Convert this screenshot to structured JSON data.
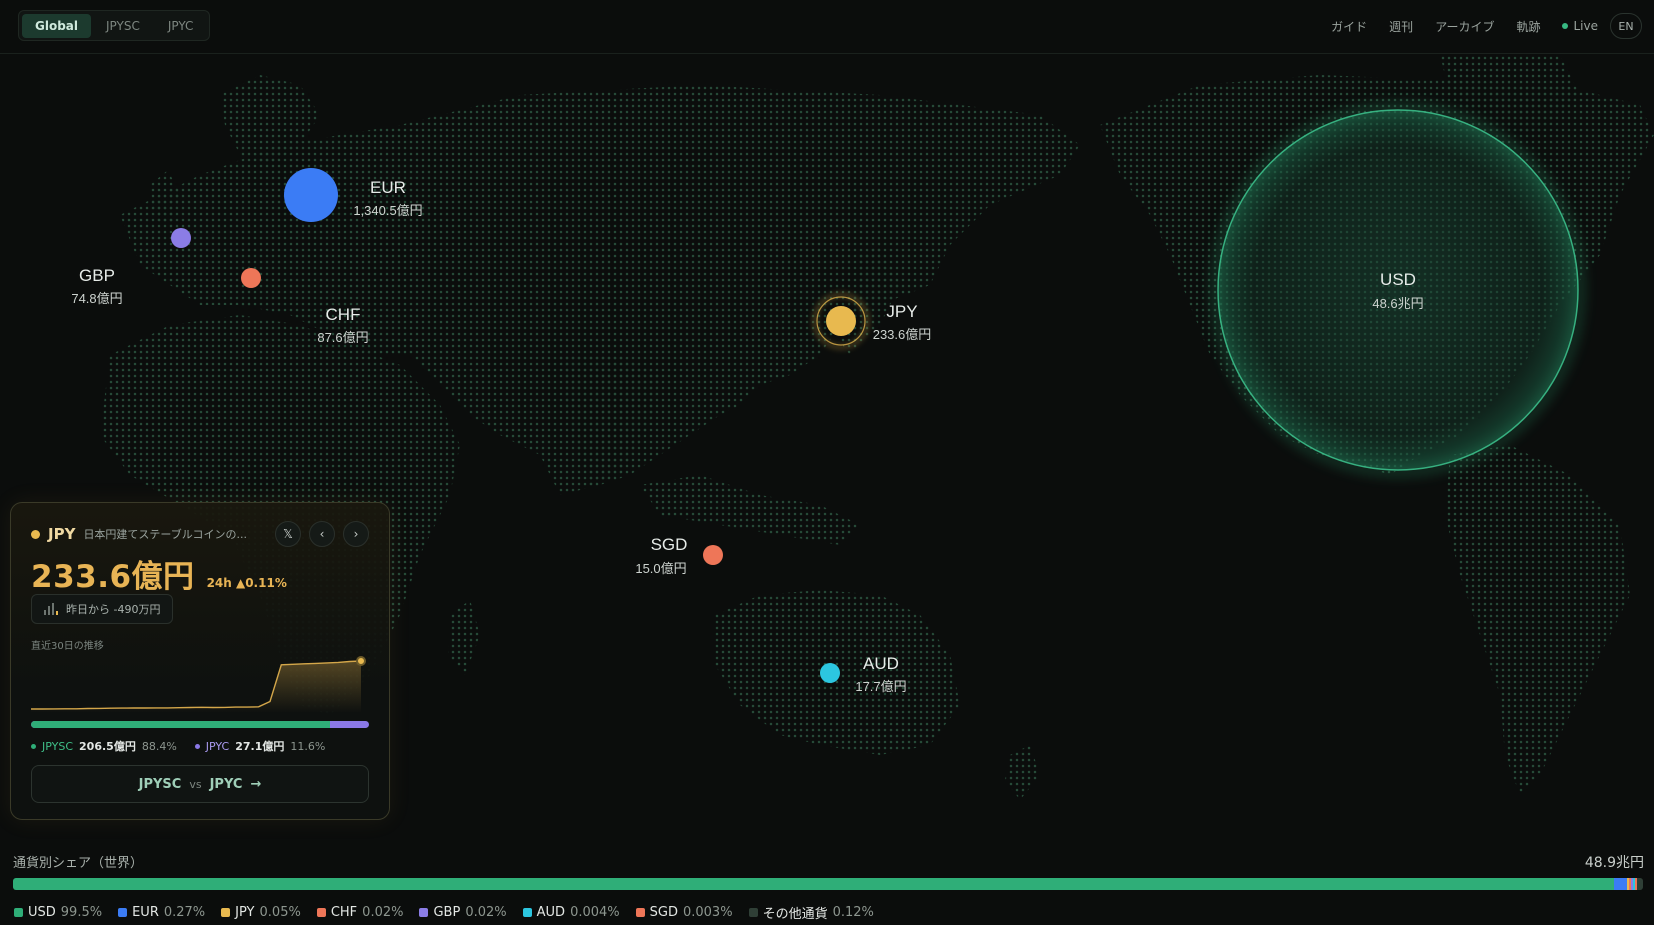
{
  "scope_tabs": [
    {
      "label": "Global",
      "active": true
    },
    {
      "label": "JPYSC",
      "active": false
    },
    {
      "label": "JPYC",
      "active": false
    }
  ],
  "topnav": {
    "guide": "ガイド",
    "weekly": "週刊",
    "archive": "アーカイブ",
    "track": "軌跡",
    "live": "Live",
    "lang": "EN"
  },
  "map_markers": [
    {
      "code": "EUR",
      "value": "1,340.5億円",
      "color": "#3b7cf5"
    },
    {
      "code": "GBP",
      "value": "74.8億円",
      "color": "#8b7de6"
    },
    {
      "code": "CHF",
      "value": "87.6億円",
      "color": "#ee7658"
    },
    {
      "code": "JPY",
      "value": "233.6億円",
      "color": "#e8b94f"
    },
    {
      "code": "SGD",
      "value": "15.0億円",
      "color": "#ee7658"
    },
    {
      "code": "AUD",
      "value": "17.7億円",
      "color": "#2cc6e0"
    },
    {
      "code": "USD",
      "value": "48.6兆円",
      "color": "#2fae78"
    }
  ],
  "card": {
    "code": "JPY",
    "description": "日本円建てステーブルコインの...",
    "x_icon": "x-logo-icon",
    "amount": "233.6億円",
    "change_24h": "24h ▲0.11%",
    "day_change": "昨日から -490万円",
    "trend_label": "直近30日の推移",
    "trend_30d": [
      33,
      33,
      33.1,
      33.2,
      33.2,
      33.5,
      33.6,
      33.8,
      34,
      34.1,
      34.1,
      34.2,
      34.2,
      34.4,
      34.6,
      34.8,
      34.6,
      34.7,
      35,
      35,
      35.3,
      41,
      80,
      80.5,
      81,
      81.5,
      82,
      82.5,
      83.5,
      84
    ],
    "split": {
      "jpysc_label": "JPYSC",
      "jpysc_value": "206.5億円",
      "jpysc_pct": "88.4%",
      "jpysc_share": 0.884,
      "jpyc_label": "JPYC",
      "jpyc_value": "27.1億円",
      "jpyc_pct": "11.6%"
    },
    "compare": {
      "left": "JPYSC",
      "vs": "vs",
      "right": "JPYC",
      "arrow": "→"
    }
  },
  "share": {
    "title": "通貨別シェア（世界）",
    "total": "48.9兆円",
    "items": [
      {
        "name": "USD",
        "pct": "99.5%",
        "share": 0.995,
        "color": "#2fae78"
      },
      {
        "name": "EUR",
        "pct": "0.27%",
        "share": 0.0027,
        "color": "#3b7cf5"
      },
      {
        "name": "JPY",
        "pct": "0.05%",
        "share": 0.0005,
        "color": "#e8b94f"
      },
      {
        "name": "CHF",
        "pct": "0.02%",
        "share": 0.0002,
        "color": "#ee7658"
      },
      {
        "name": "GBP",
        "pct": "0.02%",
        "share": 0.0002,
        "color": "#8b7de6"
      },
      {
        "name": "AUD",
        "pct": "0.004%",
        "share": 4e-05,
        "color": "#2cc6e0"
      },
      {
        "name": "SGD",
        "pct": "0.003%",
        "share": 3e-05,
        "color": "#ee7658"
      },
      {
        "name": "その他通貨",
        "pct": "0.12%",
        "share": 0.0012,
        "color": "#2f3f36"
      }
    ]
  }
}
